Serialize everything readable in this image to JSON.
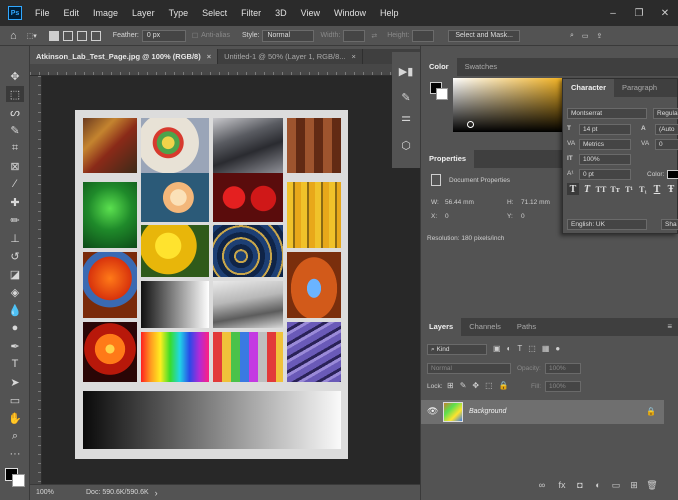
{
  "app": {
    "logo": "Ps"
  },
  "menu": [
    "File",
    "Edit",
    "Image",
    "Layer",
    "Type",
    "Select",
    "Filter",
    "3D",
    "View",
    "Window",
    "Help"
  ],
  "window_controls": {
    "minimize": "–",
    "restore": "❐",
    "close": "✕"
  },
  "options": {
    "feather_label": "Feather:",
    "feather_value": "0 px",
    "antialias_label": "Anti-alias",
    "style_label": "Style:",
    "style_value": "Normal",
    "width_label": "Width:",
    "height_label": "Height:",
    "select_mask_label": "Select and Mask..."
  },
  "tabs": [
    {
      "label": "Atkinson_Lab_Test_Page.jpg @ 100% (RGB/8)",
      "close": "×"
    },
    {
      "label": "Untitled-1 @ 50% (Layer 1, RGB/8...",
      "close": "×"
    }
  ],
  "status": {
    "zoom": "100%",
    "doc": "Doc: 590.6K/590.6K",
    "arrow": "›"
  },
  "color_panel": {
    "tabs": [
      "Color",
      "Swatches"
    ]
  },
  "properties_panel": {
    "title": "Properties",
    "doc_props": "Document Properties",
    "w_label": "W:",
    "w_value": "56.44 mm",
    "h_label": "H:",
    "h_value": "71.12 mm",
    "x_label": "X:",
    "x_value": "0",
    "y_label": "Y:",
    "y_value": "0",
    "resolution": "Resolution: 180 pixels/inch"
  },
  "character_panel": {
    "tabs": [
      "Character",
      "Paragraph"
    ],
    "font_family": "Montserrat",
    "font_style": "Regula",
    "size": "14 pt",
    "leading": "(Auto",
    "kerning": "Metrics",
    "tracking": "0",
    "vscale": "100%",
    "baseline": "0 pt",
    "color_label": "Color:",
    "language": "English: UK",
    "aa": "Sha",
    "type_buttons": [
      "T",
      "T",
      "TT",
      "Tт",
      "T¹",
      "T₁",
      "T",
      "Ŧ"
    ]
  },
  "layers_panel": {
    "tabs": [
      "Layers",
      "Channels",
      "Paths"
    ],
    "kind": "Kind",
    "blend": "Normal",
    "opacity_label": "Opacity:",
    "opacity_value": "100%",
    "lock_label": "Lock:",
    "fill_label": "Fill:",
    "fill_value": "100%",
    "layer_name": "Background"
  },
  "colors": {
    "accent": "#31a8ff",
    "panel_bg": "#535353",
    "dark_bg": "#282828"
  }
}
